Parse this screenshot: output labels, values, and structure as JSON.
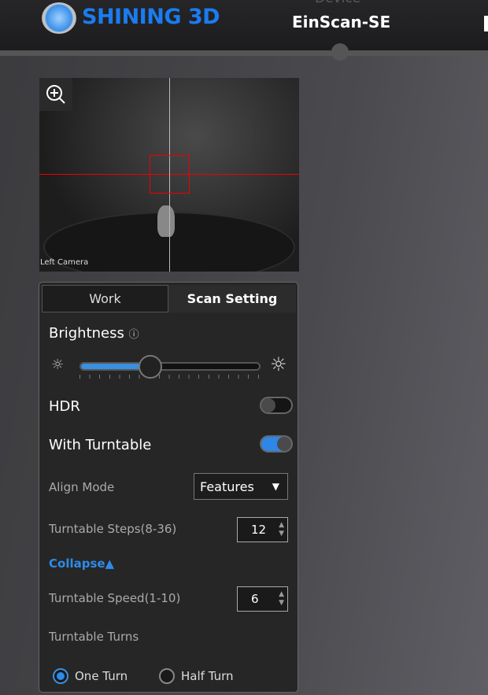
{
  "header": {
    "brand": "SHINING 3D",
    "device_label": "Device",
    "device_name": "EinScan-SE"
  },
  "camera": {
    "label": "Left Camera"
  },
  "tabs": [
    {
      "label": "Work"
    },
    {
      "label": "Scan Setting"
    }
  ],
  "settings": {
    "brightness_label": "Brightness",
    "brightness_value_percent": 39,
    "hdr_label": "HDR",
    "hdr_on": false,
    "turntable_label": "With Turntable",
    "turntable_on": true,
    "align_mode_label": "Align Mode",
    "align_mode_value": "Features",
    "steps_label": "Turntable Steps(8-36)",
    "steps_value": "12",
    "collapse_label": "Collapse▲",
    "speed_label": "Turntable Speed(1-10)",
    "speed_value": "6",
    "turns_label": "Turntable Turns",
    "turns_options": [
      {
        "label": "One Turn",
        "selected": true
      },
      {
        "label": "Half Turn",
        "selected": false
      }
    ]
  },
  "colors": {
    "accent": "#2f8ae8",
    "brand": "#1a7cf0"
  }
}
